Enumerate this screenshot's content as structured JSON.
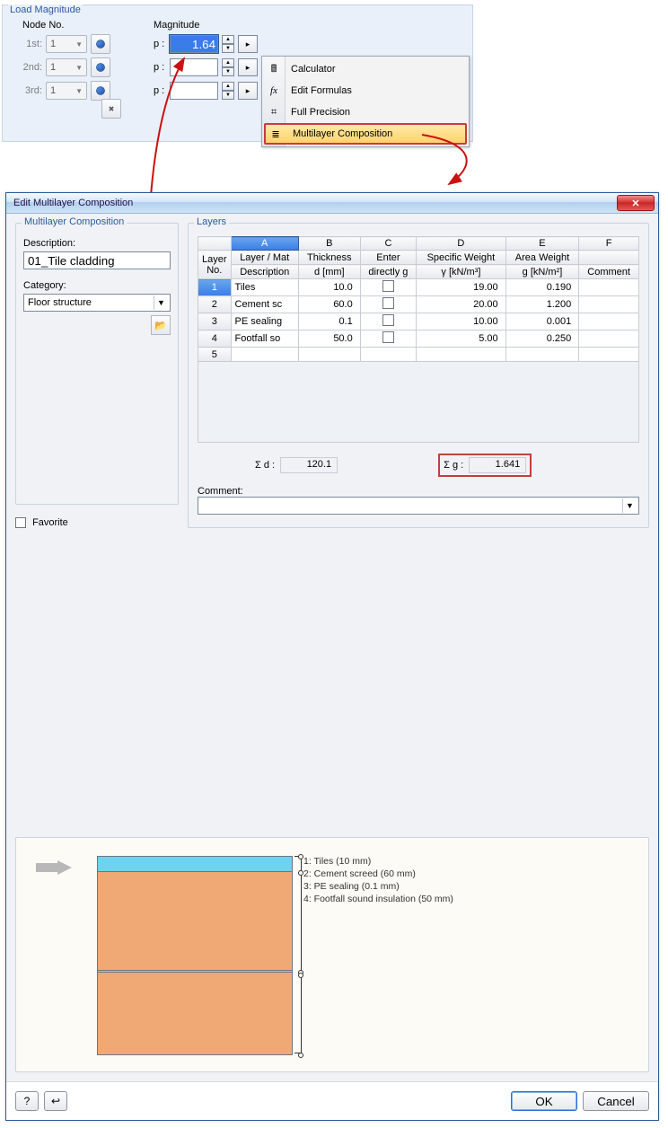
{
  "top": {
    "title": "Load Magnitude",
    "node_col": "Node No.",
    "mag_col": "Magnitude",
    "ord": [
      "1st:",
      "2nd:",
      "3rd:"
    ],
    "p": "p :",
    "node_vals": [
      "1",
      "1",
      "1"
    ],
    "mag_vals": [
      "1.64",
      "",
      ""
    ]
  },
  "ctx": {
    "items": [
      {
        "icon": "🖩",
        "label": "Calculator"
      },
      {
        "icon": "fx",
        "label": "Edit Formulas"
      },
      {
        "icon": "⌗",
        "label": "Full Precision"
      },
      {
        "icon": "≣",
        "label": "Multilayer Composition"
      }
    ]
  },
  "dlg": {
    "title": "Edit Multilayer Composition",
    "left_group": "Multilayer Composition",
    "desc_label": "Description:",
    "desc_value": "01_Tile cladding",
    "cat_label": "Category:",
    "cat_value": "Floor structure",
    "fav_label": "Favorite",
    "layers_title": "Layers",
    "col_letters": [
      "A",
      "B",
      "C",
      "D",
      "E",
      "F"
    ],
    "layer_no": "Layer No.",
    "headers": [
      [
        "Layer / Mat",
        "Description"
      ],
      [
        "Thickness",
        "d [mm]"
      ],
      [
        "Enter",
        "directly g"
      ],
      [
        "Specific Weight",
        "γ [kN/m³]"
      ],
      [
        "Area Weight",
        "g [kN/m²]"
      ],
      [
        "",
        "Comment"
      ]
    ],
    "rows": [
      {
        "no": "1",
        "mat": "Tiles",
        "d": "10.0",
        "sw": "19.00",
        "aw": "0.190"
      },
      {
        "no": "2",
        "mat": "Cement sc",
        "d": "60.0",
        "sw": "20.00",
        "aw": "1.200"
      },
      {
        "no": "3",
        "mat": "PE sealing",
        "d": "0.1",
        "sw": "10.00",
        "aw": "0.001"
      },
      {
        "no": "4",
        "mat": "Footfall so",
        "d": "50.0",
        "sw": "5.00",
        "aw": "0.250"
      },
      {
        "no": "5",
        "mat": "",
        "d": "",
        "sw": "",
        "aw": ""
      }
    ],
    "sum_d_label": "Σ d :",
    "sum_d_value": "120.1",
    "sum_g_label": "Σ g :",
    "sum_g_value": "1.641",
    "comment_label": "Comment:",
    "preview_labels": [
      "1: Tiles (10 mm)",
      "2: Cement screed (60 mm)",
      "3: PE sealing (0.1 mm)",
      "4: Footfall sound insulation (50 mm)"
    ],
    "ok": "OK",
    "cancel": "Cancel"
  },
  "chart_data": {
    "type": "table",
    "title": "Layers",
    "columns": [
      "Layer No.",
      "Layer / Mat Description",
      "Thickness d [mm]",
      "Enter directly g",
      "Specific Weight γ [kN/m³]",
      "Area Weight g [kN/m²]",
      "Comment"
    ],
    "rows": [
      [
        1,
        "Tiles",
        10.0,
        false,
        19.0,
        0.19,
        ""
      ],
      [
        2,
        "Cement screed",
        60.0,
        false,
        20.0,
        1.2,
        ""
      ],
      [
        3,
        "PE sealing",
        0.1,
        false,
        10.0,
        0.001,
        ""
      ],
      [
        4,
        "Footfall sound insulation",
        50.0,
        false,
        5.0,
        0.25,
        ""
      ]
    ],
    "totals": {
      "sum_d_mm": 120.1,
      "sum_g_kN_per_m2": 1.641
    }
  }
}
